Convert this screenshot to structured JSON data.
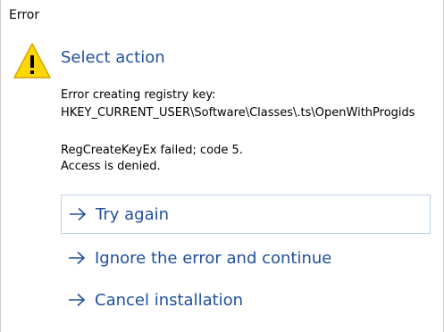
{
  "window": {
    "title": "Error"
  },
  "dialog": {
    "icon": "warning-icon",
    "heading": "Select action",
    "message_lines": [
      "Error creating registry key:",
      "HKEY_CURRENT_USER\\Software\\Classes\\.ts\\OpenWithProgids",
      "RegCreateKeyEx failed; code 5.",
      "Access is denied."
    ],
    "commands": [
      {
        "label": "Try again",
        "icon": "arrow-right-icon",
        "focused": true
      },
      {
        "label": "Ignore the error and continue",
        "icon": "arrow-right-icon",
        "focused": false
      },
      {
        "label": "Cancel installation",
        "icon": "arrow-right-icon",
        "focused": false
      }
    ]
  },
  "colors": {
    "accent": "#1f4fa0",
    "warning_fill": "#ffd700",
    "focus_border": "#b9cfe6"
  }
}
